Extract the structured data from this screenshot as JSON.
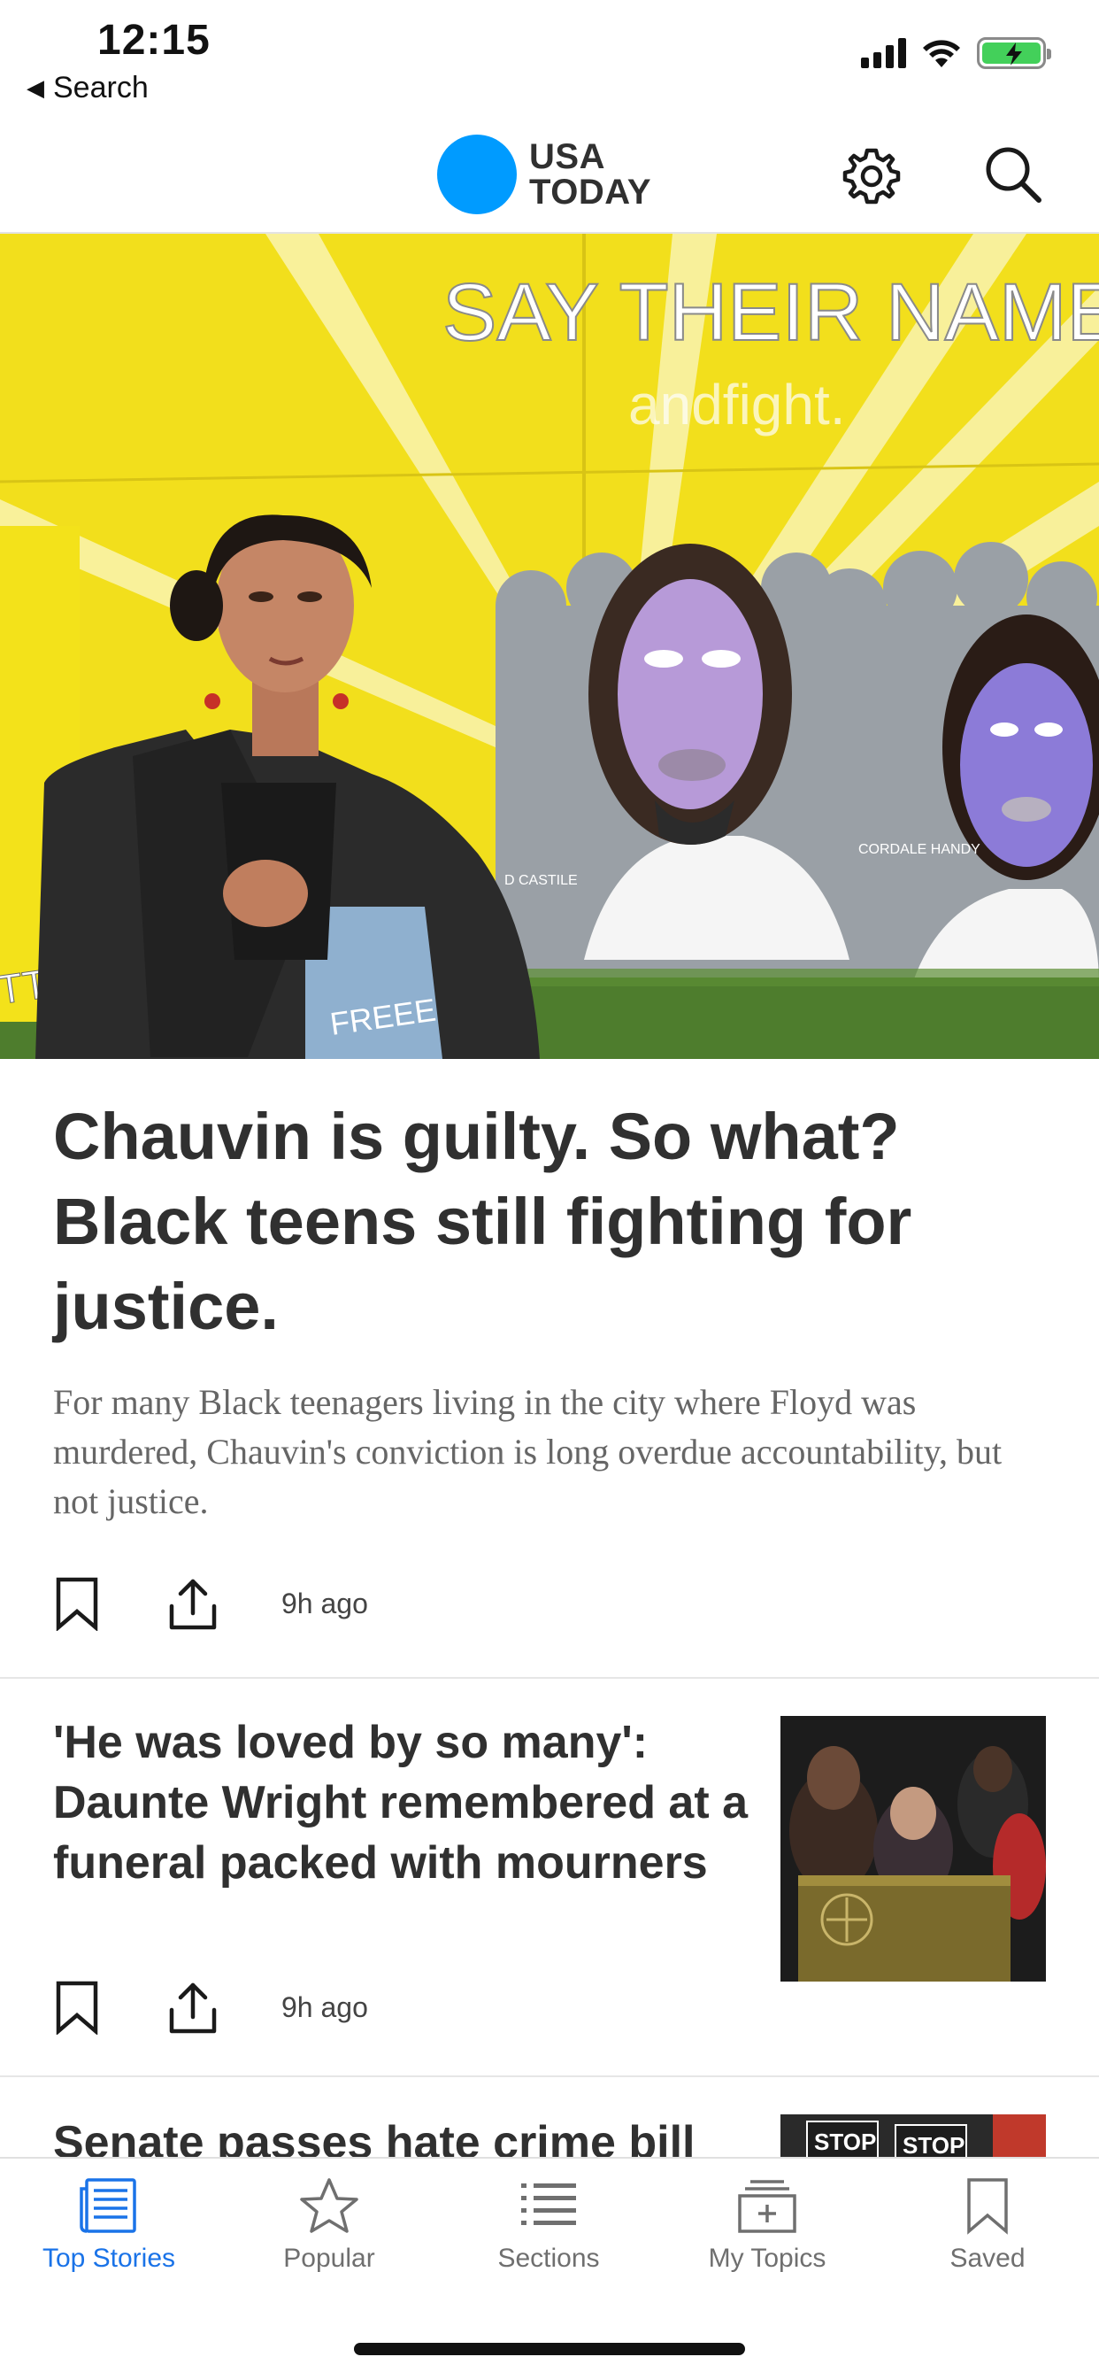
{
  "status_bar": {
    "time": "12:15",
    "back_label": "Search"
  },
  "header": {
    "logo_line1": "USA",
    "logo_line2": "TODAY",
    "brand_color": "#009bff"
  },
  "hero": {
    "mural_title": "SAY THEIR NAMES",
    "mural_subtitle": "andfight.",
    "mural_name_1": "CORDALE HANDY",
    "mural_name_2": "D CASTILE",
    "jeans_text": "FREEE",
    "left_edge_text": "TTER"
  },
  "stories": [
    {
      "headline": "Chauvin is guilty. So what? Black teens still fighting for justice.",
      "summary": "For many Black teenagers living in the city where Floyd was murdered, Chauvin's conviction is long overdue accountability, but not justice.",
      "time": "9h ago"
    },
    {
      "headline": "'He was loved by so many': Daunte Wright remembered at a funeral packed with mourners",
      "time": "9h ago"
    },
    {
      "headline": "Senate passes hate crime bill",
      "thumb_sign": "STOP"
    }
  ],
  "tabs": [
    {
      "label": "Top Stories",
      "icon": "newspaper-icon",
      "active": true
    },
    {
      "label": "Popular",
      "icon": "star-icon",
      "active": false
    },
    {
      "label": "Sections",
      "icon": "list-icon",
      "active": false
    },
    {
      "label": "My Topics",
      "icon": "add-topic-icon",
      "active": false
    },
    {
      "label": "Saved",
      "icon": "bookmark-icon",
      "active": false
    }
  ],
  "colors": {
    "active_tab": "#1a73e8",
    "inactive_tab": "#6f6f6f",
    "mural_yellow": "#f1dd1e"
  }
}
